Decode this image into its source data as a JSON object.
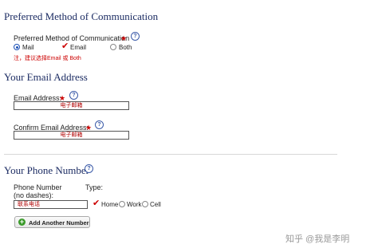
{
  "communication": {
    "heading": "Preferred Method of Communication",
    "label": "Preferred Method of Communication",
    "required_mark": "★",
    "help_glyph": "?",
    "options": [
      {
        "label": "Mail",
        "selected": true
      },
      {
        "label": "Email",
        "checked": true
      },
      {
        "label": "Both",
        "selected": false
      }
    ],
    "note": "注，建议选择Email 或 Both"
  },
  "email": {
    "heading": "Your Email Address",
    "address_label": "Email Address:",
    "address_value": "电子邮箱",
    "confirm_label": "Confirm Email Address:",
    "confirm_value": "电子邮箱",
    "required_mark": "★",
    "help_glyph": "?"
  },
  "phone": {
    "heading": "Your Phone Number",
    "help_glyph": "?",
    "number_label_line1": "Phone Number",
    "number_label_line2": "(no dashes):",
    "type_label": "Type:",
    "number_value": "联系电话",
    "types": [
      {
        "label": "Home",
        "checked": true
      },
      {
        "label": "Work",
        "selected": false
      },
      {
        "label": "Cell",
        "selected": false
      }
    ],
    "add_button": "Add Another Number",
    "add_glyph": "+"
  },
  "watermark": "知乎 @我是李明",
  "colors": {
    "heading": "#1c2c63",
    "required": "#cc0000",
    "radio": "#1a4fb5",
    "add_icon": "#3a9a2a"
  }
}
